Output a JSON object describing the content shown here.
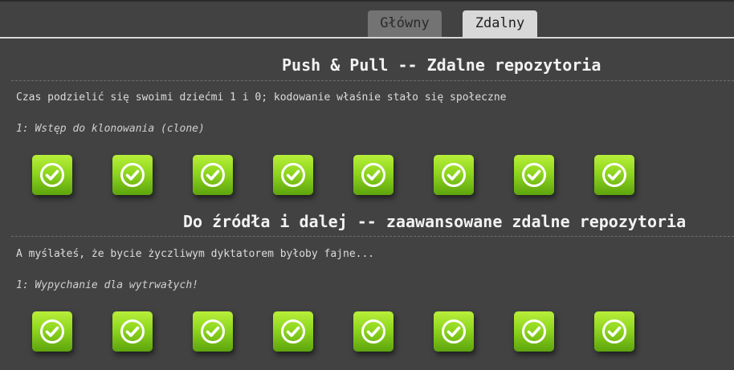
{
  "tabs": [
    {
      "label": "Główny",
      "active": false
    },
    {
      "label": "Zdalny",
      "active": true
    }
  ],
  "sections": [
    {
      "title": "Push & Pull -- Zdalne repozytoria",
      "description": "Czas podzielić się swoimi dziećmi 1 i 0; kodowanie właśnie stało się społeczne",
      "subtitle": "1: Wstęp do klonowania (clone)",
      "levels": [
        {
          "status": "completed",
          "icon": "check-circle-icon"
        },
        {
          "status": "completed",
          "icon": "check-circle-icon"
        },
        {
          "status": "completed",
          "icon": "check-circle-icon"
        },
        {
          "status": "completed",
          "icon": "check-circle-icon"
        },
        {
          "status": "completed",
          "icon": "check-circle-icon"
        },
        {
          "status": "completed",
          "icon": "check-circle-icon"
        },
        {
          "status": "completed",
          "icon": "check-circle-icon"
        },
        {
          "status": "completed",
          "icon": "check-circle-icon"
        }
      ]
    },
    {
      "title": "Do źródła i dalej -- zaawansowane zdalne repozytoria",
      "description": "A myślałeś, że bycie życzliwym dyktatorem byłoby fajne...",
      "subtitle": "1: Wypychanie dla wytrwałych!",
      "levels": [
        {
          "status": "completed",
          "icon": "check-circle-icon"
        },
        {
          "status": "completed",
          "icon": "check-circle-icon"
        },
        {
          "status": "completed",
          "icon": "check-circle-icon"
        },
        {
          "status": "completed",
          "icon": "check-circle-icon"
        },
        {
          "status": "completed",
          "icon": "check-circle-icon"
        },
        {
          "status": "completed",
          "icon": "check-circle-icon"
        },
        {
          "status": "completed",
          "icon": "check-circle-icon"
        },
        {
          "status": "completed",
          "icon": "check-circle-icon"
        }
      ]
    }
  ],
  "colors": {
    "background": "#424242",
    "tab_active": "#d8d8d8",
    "tab_inactive": "#737373",
    "level_green": "#8fd61f"
  }
}
